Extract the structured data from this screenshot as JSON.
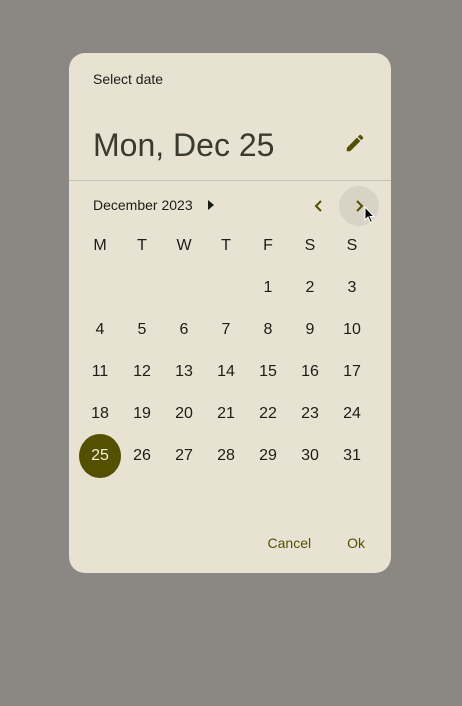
{
  "dialog": {
    "supporting_text": "Select date",
    "headline": "Mon, Dec 25",
    "edit_icon": "pencil-icon",
    "month_year": "December 2023",
    "nav_prev_icon": "chevron-left-icon",
    "nav_next_icon": "chevron-right-icon",
    "weekdays": [
      "M",
      "T",
      "W",
      "T",
      "F",
      "S",
      "S"
    ],
    "weeks": [
      [
        "",
        "",
        "",
        "",
        "1",
        "2",
        "3"
      ],
      [
        "4",
        "5",
        "6",
        "7",
        "8",
        "9",
        "10"
      ],
      [
        "11",
        "12",
        "13",
        "14",
        "15",
        "16",
        "17"
      ],
      [
        "18",
        "19",
        "20",
        "21",
        "22",
        "23",
        "24"
      ],
      [
        "25",
        "26",
        "27",
        "28",
        "29",
        "30",
        "31"
      ]
    ],
    "selected_day": "25",
    "cancel_label": "Cancel",
    "ok_label": "Ok"
  },
  "colors": {
    "scrim": "#8b8782",
    "surface": "#e8e2d3",
    "accent": "#535100",
    "on_accent": "#f4efd9",
    "text": "#1d1c16"
  }
}
